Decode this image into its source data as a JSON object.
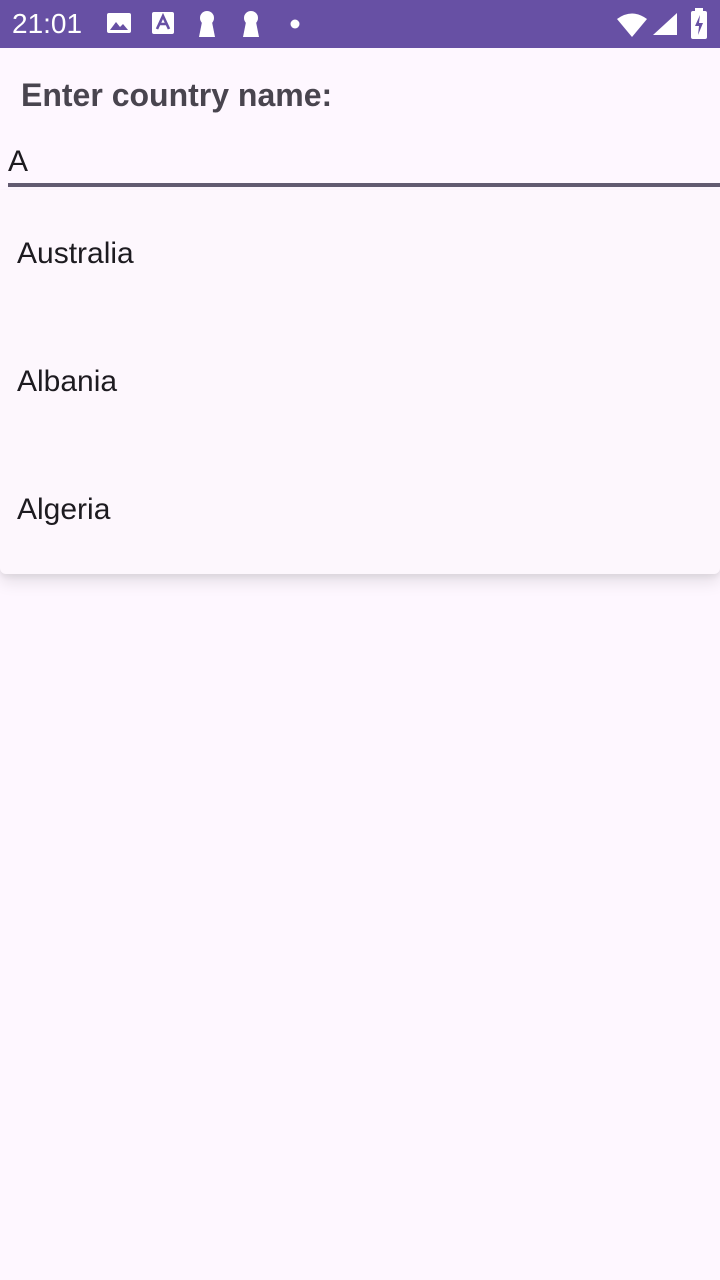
{
  "status_bar": {
    "time": "21:01",
    "left_icons": [
      "image-icon",
      "text-a-icon",
      "keyhole-icon",
      "keyhole-icon",
      "dot-icon"
    ],
    "right_icons": [
      "wifi-icon",
      "signal-icon",
      "battery-icon"
    ],
    "background": "#6750a4"
  },
  "form": {
    "label": "Enter country name:",
    "input_value": "A"
  },
  "suggestions": [
    {
      "label": "Australia"
    },
    {
      "label": "Albania"
    },
    {
      "label": "Algeria"
    }
  ],
  "colors": {
    "accent": "#6750a4",
    "background": "#fef7ff",
    "underline": "#625b71"
  }
}
